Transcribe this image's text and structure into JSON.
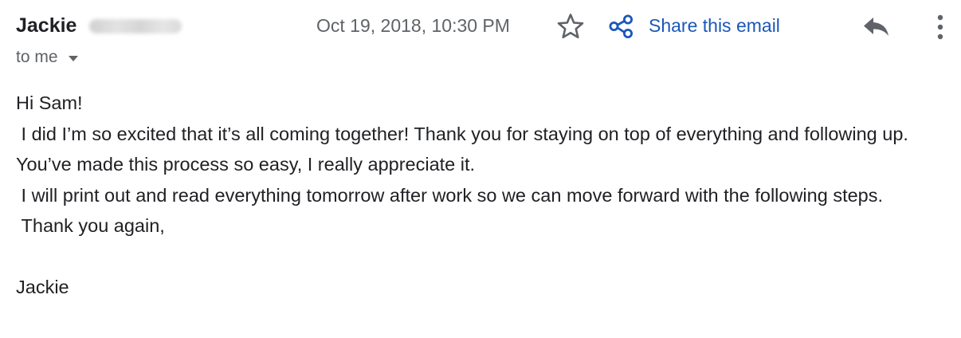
{
  "header": {
    "sender_name": "Jackie",
    "recipient_label": "to me",
    "timestamp": "Oct 19, 2018, 10:30 PM",
    "share_label": "Share this email",
    "accent_color": "#1a57b9",
    "icons": {
      "star": "star-outline-icon",
      "share": "share-icon",
      "reply": "reply-icon",
      "more": "more-vertical-icon",
      "recipient_dropdown": "caret-down-icon"
    }
  },
  "message": {
    "greeting": "Hi Sam!",
    "line1": " I did I’m so excited that it’s all coming together! Thank you for staying on top of everything and following up. You’ve made this process so easy, I really appreciate it.",
    "line2": " I will print out and read everything tomorrow after work so we can move forward with the following steps.",
    "line3": " Thank you again,",
    "signature": "Jackie"
  }
}
